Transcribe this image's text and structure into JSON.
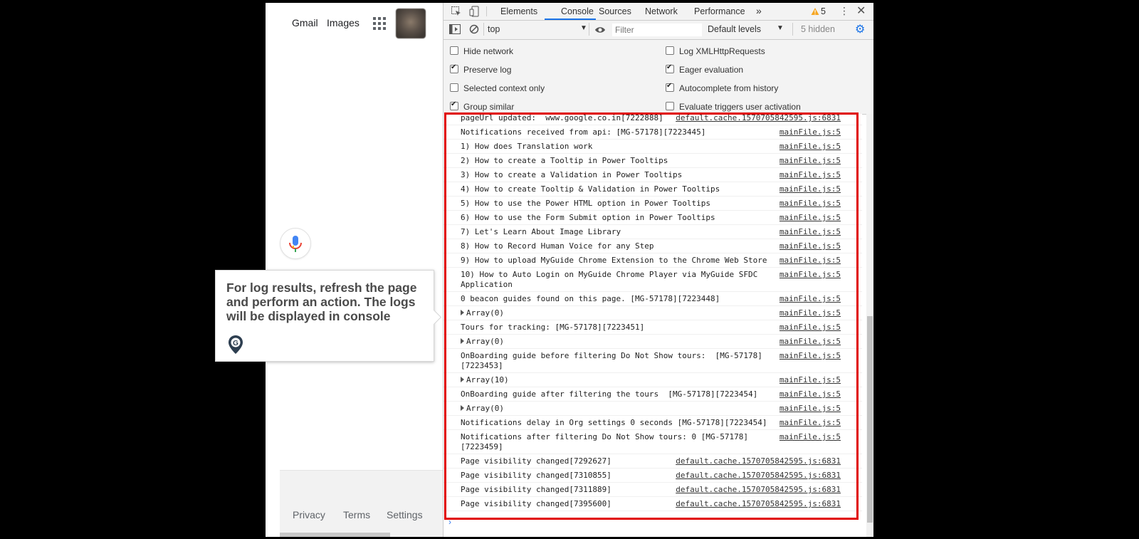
{
  "google": {
    "gmail": "Gmail",
    "images": "Images",
    "footer": {
      "privacy": "Privacy",
      "terms": "Terms",
      "settings": "Settings"
    }
  },
  "tooltip": {
    "text": "For log results, refresh the page and perform an action. The logs will be displayed in console"
  },
  "devtools": {
    "tabs": [
      "Elements",
      "Console",
      "Sources",
      "Network",
      "Performance"
    ],
    "active_tab": "Console",
    "more_tabs": "»",
    "warnings": "5",
    "context": "top",
    "filter_placeholder": "Filter",
    "levels": "Default levels",
    "hidden": "5 hidden",
    "settings_left": [
      {
        "label": "Hide network",
        "checked": false
      },
      {
        "label": "Preserve log",
        "checked": true
      },
      {
        "label": "Selected context only",
        "checked": false
      },
      {
        "label": "Group similar",
        "checked": true
      }
    ],
    "settings_right": [
      {
        "label": "Log XMLHttpRequests",
        "checked": false
      },
      {
        "label": "Eager evaluation",
        "checked": true
      },
      {
        "label": "Autocomplete from history",
        "checked": true
      },
      {
        "label": "Evaluate triggers user activation",
        "checked": false
      }
    ],
    "logs": [
      {
        "msg": "pageUrl updated:  www.google.co.in[7222888]",
        "src": "default.cache.1570705842595.js:6831"
      },
      {
        "msg": "Notifications received from api: [MG-57178][7223445]",
        "src": "mainFile.js:5"
      },
      {
        "msg": "1) How does Translation work",
        "src": "mainFile.js:5"
      },
      {
        "msg": "2) How to create a Tooltip in Power Tooltips",
        "src": "mainFile.js:5"
      },
      {
        "msg": "3) How to create a Validation in Power Tooltips",
        "src": "mainFile.js:5"
      },
      {
        "msg": "4) How to create Tooltip & Validation in Power Tooltips",
        "src": "mainFile.js:5"
      },
      {
        "msg": "5) How to use the Power HTML option in Power Tooltips",
        "src": "mainFile.js:5"
      },
      {
        "msg": "6) How to use the Form Submit option in Power Tooltips",
        "src": "mainFile.js:5"
      },
      {
        "msg": "7) Let's Learn About Image Library",
        "src": "mainFile.js:5"
      },
      {
        "msg": "8) How to Record Human Voice for any Step",
        "src": "mainFile.js:5"
      },
      {
        "msg": "9) How to upload MyGuide Chrome Extension to the Chrome Web Store",
        "src": "mainFile.js:5"
      },
      {
        "msg": "10) How to Auto Login on MyGuide Chrome Player via MyGuide SFDC\nApplication",
        "src": "mainFile.js:5"
      },
      {
        "msg": "0 beacon guides found on this page. [MG-57178][7223448]",
        "src": "mainFile.js:5"
      },
      {
        "msg": "Array(0)",
        "src": "mainFile.js:5",
        "expandable": true
      },
      {
        "msg": "Tours for tracking: [MG-57178][7223451]",
        "src": "mainFile.js:5"
      },
      {
        "msg": "Array(0)",
        "src": "mainFile.js:5",
        "expandable": true
      },
      {
        "msg": "OnBoarding guide before filtering Do Not Show tours:  [MG-57178]\n[7223453]",
        "src": "mainFile.js:5"
      },
      {
        "msg": "Array(10)",
        "src": "mainFile.js:5",
        "expandable": true
      },
      {
        "msg": "OnBoarding guide after filtering the tours  [MG-57178][7223454]",
        "src": "mainFile.js:5"
      },
      {
        "msg": "Array(0)",
        "src": "mainFile.js:5",
        "expandable": true
      },
      {
        "msg": "Notifications delay in Org settings 0 seconds [MG-57178][7223454]",
        "src": "mainFile.js:5"
      },
      {
        "msg": "Notifications after filtering Do Not Show tours: 0 [MG-57178]\n[7223459]",
        "src": "mainFile.js:5"
      },
      {
        "msg": "Page visibility changed[7292627]",
        "src": "default.cache.1570705842595.js:6831"
      },
      {
        "msg": "Page visibility changed[7310855]",
        "src": "default.cache.1570705842595.js:6831"
      },
      {
        "msg": "Page visibility changed[7311889]",
        "src": "default.cache.1570705842595.js:6831"
      },
      {
        "msg": "Page visibility changed[7395600]",
        "src": "default.cache.1570705842595.js:6831"
      }
    ],
    "prompt": "›"
  }
}
